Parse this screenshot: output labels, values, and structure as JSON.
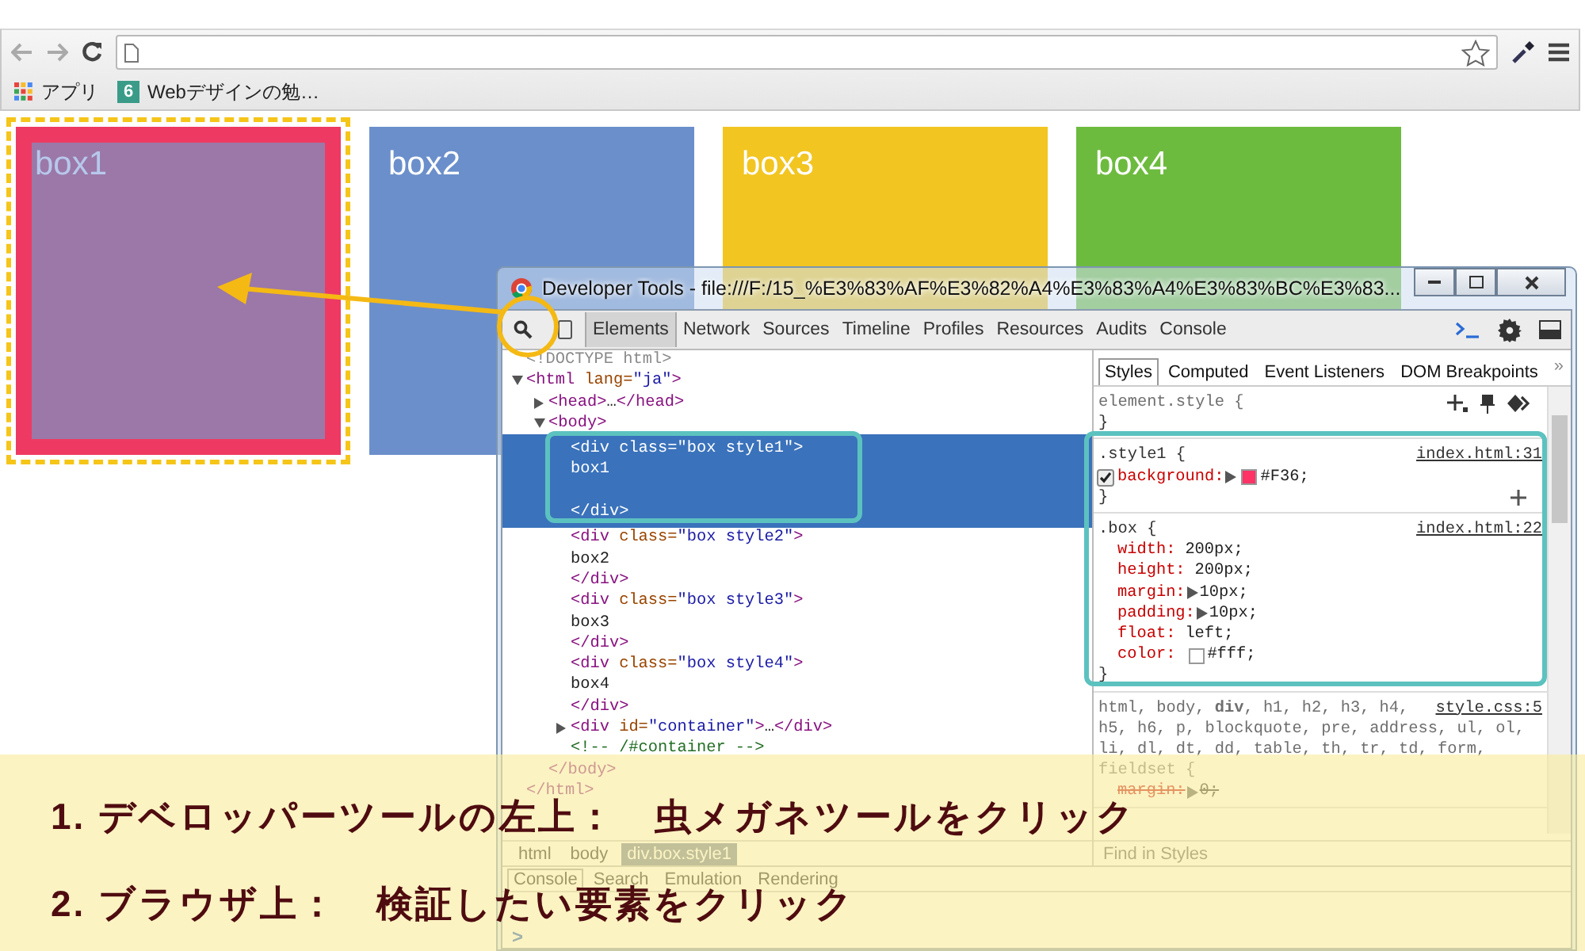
{
  "browser": {
    "bookmarks": [
      {
        "label": "アプリ",
        "kind": "apps"
      },
      {
        "label": "Webデザインの勉…",
        "kind": "site",
        "icon_text": "6"
      }
    ]
  },
  "page": {
    "boxes": [
      {
        "label": "box1",
        "color": "#ee3a63",
        "inspected": true
      },
      {
        "label": "box2",
        "color": "#6b8fcb",
        "inspected": false
      },
      {
        "label": "box3",
        "color": "#f2c521",
        "inspected": false
      },
      {
        "label": "box4",
        "color": "#6dbb3e",
        "inspected": false
      }
    ]
  },
  "devtools": {
    "title": "Developer Tools - file:///F:/15_%E3%83%AF%E3%82%A4%E3%83%A4%E3%83%BC%E3%83...",
    "tabs": [
      {
        "label": "Elements",
        "selected": true
      },
      {
        "label": "Network",
        "selected": false
      },
      {
        "label": "Sources",
        "selected": false
      },
      {
        "label": "Timeline",
        "selected": false
      },
      {
        "label": "Profiles",
        "selected": false
      },
      {
        "label": "Resources",
        "selected": false
      },
      {
        "label": "Audits",
        "selected": false
      },
      {
        "label": "Console",
        "selected": false
      }
    ],
    "dom_tree": [
      {
        "lines": [
          [
            {
              "doctype": "<!DOCTYPE html>"
            }
          ]
        ],
        "selected": false
      },
      {
        "lines": [
          [
            {
              "tag": "<html"
            },
            {
              "attr": " lang="
            },
            {
              "value": "\"ja\""
            },
            {
              "tag": ">"
            }
          ]
        ],
        "selected": false,
        "expanded": true,
        "close": [
          {
            "tag": "</html>"
          }
        ],
        "children": [
          {
            "lines": [
              [
                {
                  "tag": "<head>"
                },
                {
                  "text": "…"
                },
                {
                  "tag": "</head>"
                }
              ]
            ],
            "selected": false,
            "expanded": false
          },
          {
            "lines": [
              [
                {
                  "tag": "<body>"
                }
              ]
            ],
            "selected": false,
            "expanded": true,
            "close": [
              {
                "tag": "</body>"
              }
            ],
            "children": [
              {
                "lines": [
                  [
                    {
                      "tag": "<div"
                    },
                    {
                      "attr": " class="
                    },
                    {
                      "value": "\"box style1\""
                    },
                    {
                      "tag": ">"
                    }
                  ],
                  [
                    {
                      "text": "box1"
                    }
                  ],
                  [
                    {
                      "tag": "</div>"
                    }
                  ]
                ],
                "selected": true
              },
              {
                "lines": [
                  [
                    {
                      "tag": "<div"
                    },
                    {
                      "attr": " class="
                    },
                    {
                      "value": "\"box style2\""
                    },
                    {
                      "tag": ">"
                    }
                  ],
                  [
                    {
                      "text": "box2"
                    }
                  ],
                  [
                    {
                      "tag": "</div>"
                    }
                  ]
                ],
                "selected": false
              },
              {
                "lines": [
                  [
                    {
                      "tag": "<div"
                    },
                    {
                      "attr": " class="
                    },
                    {
                      "value": "\"box style3\""
                    },
                    {
                      "tag": ">"
                    }
                  ],
                  [
                    {
                      "text": "box3"
                    }
                  ],
                  [
                    {
                      "tag": "</div>"
                    }
                  ]
                ],
                "selected": false
              },
              {
                "lines": [
                  [
                    {
                      "tag": "<div"
                    },
                    {
                      "attr": " class="
                    },
                    {
                      "value": "\"box style4\""
                    },
                    {
                      "tag": ">"
                    }
                  ],
                  [
                    {
                      "text": "box4"
                    }
                  ],
                  [
                    {
                      "tag": "</div>"
                    }
                  ]
                ],
                "selected": false
              },
              {
                "lines": [
                  [
                    {
                      "tag": "<div"
                    },
                    {
                      "attr": " id="
                    },
                    {
                      "value": "\"container\""
                    },
                    {
                      "tag": ">"
                    },
                    {
                      "text": "…"
                    },
                    {
                      "tag": "</div>"
                    }
                  ]
                ],
                "selected": false,
                "expanded": false
              },
              {
                "lines": [
                  [
                    {
                      "comment": "<!-- /#container -->"
                    }
                  ]
                ],
                "selected": false
              }
            ]
          }
        ]
      }
    ],
    "breadcrumbs": [
      {
        "label": "html",
        "selected": false
      },
      {
        "label": "body",
        "selected": false
      },
      {
        "label": "div.box.style1",
        "selected": true
      }
    ],
    "styles_tabs": [
      {
        "label": "Styles",
        "selected": true
      },
      {
        "label": "Computed",
        "selected": false
      },
      {
        "label": "Event Listeners",
        "selected": false
      },
      {
        "label": "DOM Breakpoints",
        "selected": false
      }
    ],
    "styles_tabs_more": "»",
    "rules": [
      {
        "kind": "inline",
        "selector": "element.style {",
        "close": "}",
        "add_button": false
      },
      {
        "kind": "matched",
        "selector": ".style1 {",
        "source": "index.html:31",
        "close": "}",
        "add_button": true,
        "props": [
          {
            "name": "background:",
            "value": "#F36;",
            "shorthand": true,
            "checked": true,
            "color": "#ff3366",
            "overridden": false
          }
        ]
      },
      {
        "kind": "matched",
        "selector": ".box {",
        "source": "index.html:22",
        "close": "}",
        "add_button": false,
        "props": [
          {
            "name": "width:",
            "value": "200px;",
            "shorthand": false,
            "overridden": false
          },
          {
            "name": "height:",
            "value": "200px;",
            "shorthand": false,
            "overridden": false
          },
          {
            "name": "margin:",
            "value": "10px;",
            "shorthand": true,
            "overridden": false
          },
          {
            "name": "padding:",
            "value": "10px;",
            "shorthand": true,
            "overridden": false
          },
          {
            "name": "float:",
            "value": "left;",
            "shorthand": false,
            "overridden": false
          },
          {
            "name": "color:",
            "value": "#fff;",
            "shorthand": false,
            "color": "#ffffff",
            "overridden": false
          }
        ]
      },
      {
        "kind": "matched",
        "selector_lines": [
          "html, body, **div**, h1, h2, h3, h4,",
          "h5, h6, p, blockquote, pre, address, ul, ol,",
          "li, dl, dt, dd, table, th, tr, td, form,",
          "fieldset {"
        ],
        "source": "style.css:5",
        "add_button": false,
        "props": [
          {
            "name": "margin:",
            "value": "0;",
            "shorthand": true,
            "overridden": true
          }
        ]
      }
    ],
    "filter": {
      "placeholder": "Find in Styles"
    },
    "drawer_tabs": [
      {
        "label": "Console",
        "selected": true
      },
      {
        "label": "Search",
        "selected": false
      },
      {
        "label": "Emulation",
        "selected": false
      },
      {
        "label": "Rendering",
        "selected": false
      }
    ],
    "prompt": ">"
  },
  "instructions": [
    "1. デベロッパーツールの左上：　虫メガネツールをクリック",
    "2. ブラウザ上：　検証したい要素をクリック"
  ]
}
